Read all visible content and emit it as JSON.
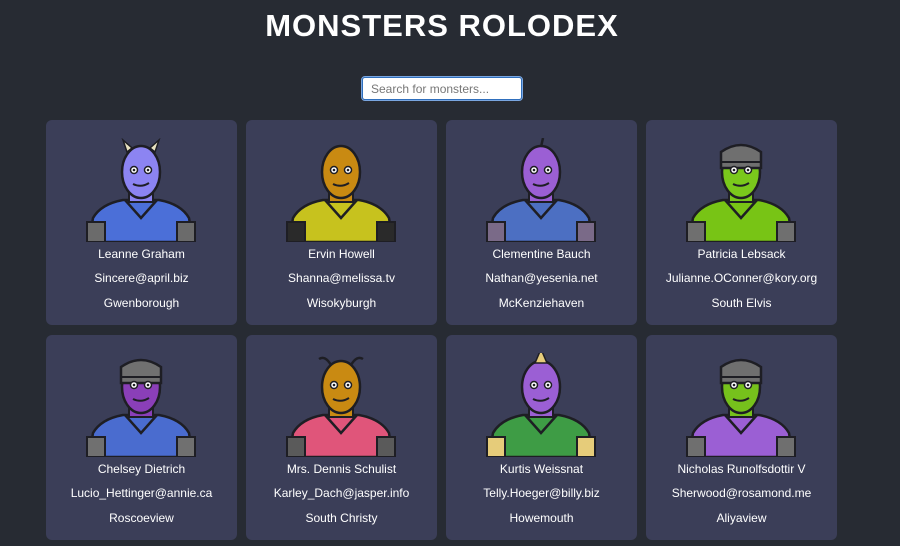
{
  "app": {
    "title": "MONSTERS ROLODEX"
  },
  "search": {
    "placeholder": "Search for monsters..."
  },
  "monsters": [
    {
      "name": "Leanne Graham",
      "email": "Sincere@april.biz",
      "city": "Gwenborough",
      "colors": {
        "head": "#8c84f2",
        "body": "#4b6fd8",
        "accent": "#6b6b6b"
      },
      "hat": "horns"
    },
    {
      "name": "Ervin Howell",
      "email": "Shanna@melissa.tv",
      "city": "Wisokyburgh",
      "colors": {
        "head": "#c98a12",
        "body": "#c7c21e",
        "accent": "#2a2a2a"
      },
      "hat": "none"
    },
    {
      "name": "Clementine Bauch",
      "email": "Nathan@yesenia.net",
      "city": "McKenziehaven",
      "colors": {
        "head": "#9b5fd4",
        "body": "#4c6fc2",
        "accent": "#7a6a88"
      },
      "hat": "antenna"
    },
    {
      "name": "Patricia Lebsack",
      "email": "Julianne.OConner@kory.org",
      "city": "South Elvis",
      "colors": {
        "head": "#7ac81c",
        "body": "#78c415",
        "accent": "#6f6f6f"
      },
      "hat": "helmet"
    },
    {
      "name": "Chelsey Dietrich",
      "email": "Lucio_Hettinger@annie.ca",
      "city": "Roscoeview",
      "colors": {
        "head": "#8a3fb8",
        "body": "#4a6ccf",
        "accent": "#707070"
      },
      "hat": "helmet"
    },
    {
      "name": "Mrs. Dennis Schulist",
      "email": "Karley_Dach@jasper.info",
      "city": "South Christy",
      "colors": {
        "head": "#c98a12",
        "body": "#e0557a",
        "accent": "#5a5a5a"
      },
      "hat": "antenna2"
    },
    {
      "name": "Kurtis Weissnat",
      "email": "Telly.Hoeger@billy.biz",
      "city": "Howemouth",
      "colors": {
        "head": "#9b5fd4",
        "body": "#3e9c45",
        "accent": "#e6cc7a"
      },
      "hat": "horn"
    },
    {
      "name": "Nicholas Runolfsdottir V",
      "email": "Sherwood@rosamond.me",
      "city": "Aliyaview",
      "colors": {
        "head": "#76c11c",
        "body": "#9b5fd4",
        "accent": "#6f6f6f"
      },
      "hat": "helmet"
    }
  ]
}
